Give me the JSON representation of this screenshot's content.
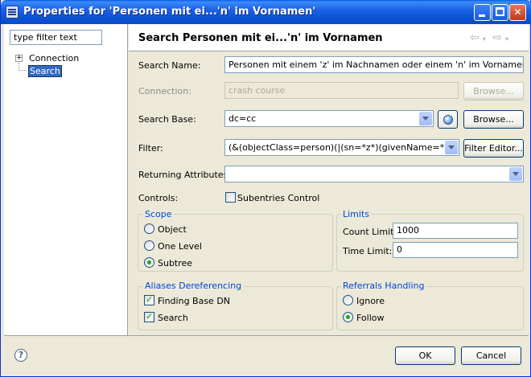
{
  "window": {
    "title": "Properties for 'Personen mit ei...'n' im Vornamen'"
  },
  "left_pane": {
    "filter_value": "type filter text",
    "tree": [
      {
        "label": "Connection",
        "expander": "+"
      },
      {
        "label": "Search",
        "selected": true
      }
    ]
  },
  "page": {
    "title": "Search Personen mit ei...'n' im Vornamen"
  },
  "form": {
    "search_name_label": "Search Name:",
    "search_name_value": "Personen mit einem 'z' im Nachnamen oder einem 'n' im Vornamen",
    "connection_label": "Connection:",
    "connection_value": "crash course",
    "connection_browse": "Browse...",
    "search_base_label": "Search Base:",
    "search_base_value": "dc=cc",
    "search_base_browse": "Browse...",
    "filter_label": "Filter:",
    "filter_value": "(&(objectClass=person)(|(sn=*z*)(givenName=*n*)))",
    "filter_editor": "Filter Editor...",
    "returning_label": "Returning Attributes:",
    "returning_value": "",
    "controls_label": "Controls:",
    "subentries_label": "Subentries Control"
  },
  "scope": {
    "title": "Scope",
    "options": [
      {
        "label": "Object",
        "checked": false
      },
      {
        "label": "One Level",
        "checked": false
      },
      {
        "label": "Subtree",
        "checked": true
      }
    ]
  },
  "limits": {
    "title": "Limits",
    "count_label": "Count Limit:",
    "count_value": "1000",
    "time_label": "Time Limit:",
    "time_value": "0"
  },
  "aliases": {
    "title": "Aliases Dereferencing",
    "options": [
      {
        "label": "Finding Base DN",
        "checked": true
      },
      {
        "label": "Search",
        "checked": true
      }
    ]
  },
  "referrals": {
    "title": "Referrals Handling",
    "options": [
      {
        "label": "Ignore",
        "checked": false
      },
      {
        "label": "Follow",
        "checked": true
      }
    ]
  },
  "buttons": {
    "ok": "OK",
    "cancel": "Cancel",
    "help": "?"
  },
  "colors": {
    "titlebar": "#0a5de5",
    "dialog_bg": "#ece9d8",
    "group_title": "#0046d5",
    "selection": "#316ac5"
  }
}
